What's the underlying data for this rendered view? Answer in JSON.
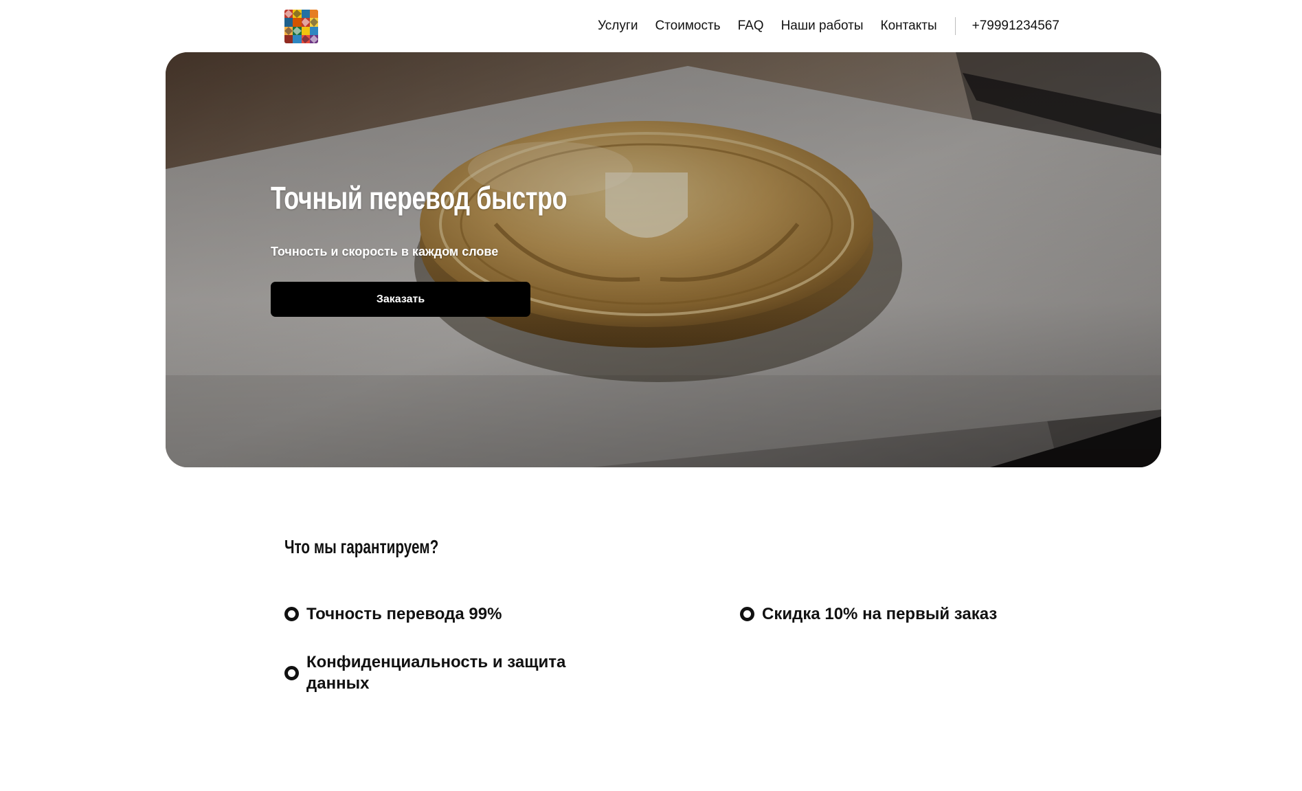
{
  "header": {
    "logo_icon": "mosaic-logo-icon",
    "nav": [
      {
        "label": "Услуги"
      },
      {
        "label": "Стоимость"
      },
      {
        "label": "FAQ"
      },
      {
        "label": "Наши работы"
      },
      {
        "label": "Контакты"
      }
    ],
    "phone": "+79991234567"
  },
  "hero": {
    "title": "Точный перевод быстро",
    "subtitle": "Точность и скорость в каждом слове",
    "cta_label": "Заказать",
    "background_image": "gold-medal-on-document-photo"
  },
  "guarantees": {
    "title": "Что мы гарантируем?",
    "items": [
      {
        "text": "Точность перевода 99%",
        "icon": "circle-bullet-icon"
      },
      {
        "text": "Скидка 10% на первый заказ",
        "icon": "circle-bullet-icon"
      },
      {
        "text": "Конфиденциальность и защита данных",
        "icon": "circle-bullet-icon"
      }
    ]
  },
  "colors": {
    "text": "#111111",
    "background": "#ffffff",
    "button": "#000000",
    "button_text": "#ffffff"
  }
}
